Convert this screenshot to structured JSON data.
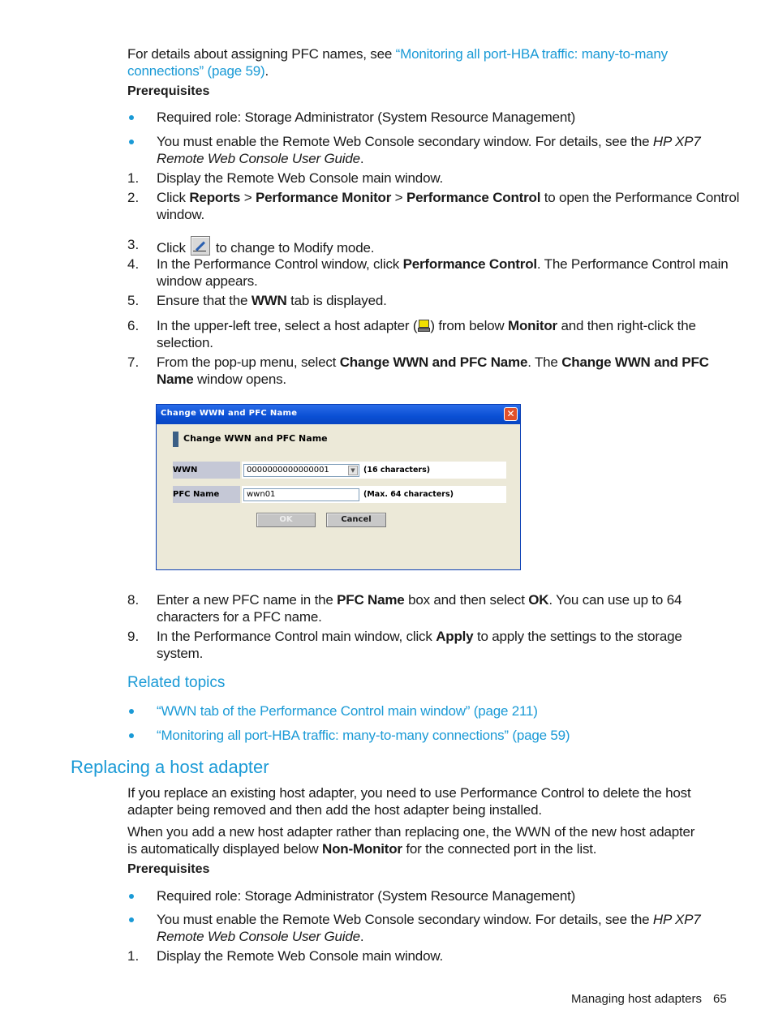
{
  "intro": {
    "text_before": "For details about assigning PFC names, see ",
    "link_line1": "“Monitoring all port-HBA traffic: many-to-many",
    "link_line2": "connections” (page 59)",
    "text_after": "."
  },
  "prereq1": {
    "heading": "Prerequisites",
    "bullets": [
      {
        "text": "Required role: Storage Administrator (System Resource Management)"
      },
      {
        "text": "You must enable the Remote Web Console secondary window. For details, see the ",
        "italic1": "HP XP7",
        "italic2": "Remote Web Console User Guide",
        "end": "."
      }
    ]
  },
  "steps": {
    "s1": {
      "num": "1.",
      "text": "Display the Remote Web Console main window."
    },
    "s2": {
      "num": "2.",
      "t1": "Click ",
      "b1": "Reports",
      "sep1": " > ",
      "b2": "Performance Monitor",
      "sep2": " > ",
      "b3": "Performance Control",
      "t2": " to open the Performance Control",
      "t3": "window."
    },
    "s3": {
      "num": "3.",
      "t1": "Click ",
      "icon": "modify-mode-icon",
      "t2": " to change to Modify mode."
    },
    "s4": {
      "num": "4.",
      "t1": "In the Performance Control window, click ",
      "b1": "Performance Control",
      "t2": ". The Performance Control main",
      "t3": "window appears."
    },
    "s5": {
      "num": "5.",
      "t1": "Ensure that the ",
      "b1": "WWN",
      "t2": " tab is displayed."
    },
    "s6": {
      "num": "6.",
      "t1": "In the upper-left tree, select a host adapter (",
      "icon": "host-adapter-icon",
      "t2": ") from below ",
      "b1": "Monitor",
      "t3": " and then right-click the",
      "t4": "selection."
    },
    "s7": {
      "num": "7.",
      "t1": "From the pop-up menu, select ",
      "b1": "Change WWN and PFC Name",
      "t2": ". The ",
      "b2": "Change WWN and PFC",
      "b3": "Name",
      "t3": " window opens."
    },
    "s8": {
      "num": "8.",
      "t1": "Enter a new PFC name in the ",
      "b1": "PFC Name",
      "t2": " box and then select ",
      "b2": "OK",
      "t3": ". You can use up to 64",
      "t4": "characters for a PFC name."
    },
    "s9": {
      "num": "9.",
      "t1": "In the Performance Control main window, click ",
      "b1": "Apply",
      "t2": " to apply the settings to the storage",
      "t3": "system."
    }
  },
  "dialog": {
    "title": "Change WWN and PFC Name",
    "heading": "Change WWN and PFC Name",
    "wwn_label": "WWN",
    "wwn_value": "0000000000000001",
    "wwn_hint": "(16 characters)",
    "pfc_label": "PFC Name",
    "pfc_value": "wwn01",
    "pfc_hint": "(Max. 64 characters)",
    "ok_label": "OK",
    "cancel_label": "Cancel",
    "close_glyph": "✕",
    "combo_glyph": "▼"
  },
  "related": {
    "heading": "Related topics",
    "links": [
      "“WWN tab of the Performance Control main window” (page 211)",
      "“Monitoring all port-HBA traffic: many-to-many connections” (page 59)"
    ]
  },
  "section2": {
    "heading": "Replacing a host adapter",
    "p1_l1": "If you replace an existing host adapter, you need to use Performance Control to delete the host",
    "p1_l2": "adapter being removed and then add the host adapter being installed.",
    "p2_l1": "When you add a new host adapter rather than replacing one, the WWN of the new host adapter",
    "p2_l2_a": "is automatically displayed below ",
    "p2_l2_b": "Non-Monitor",
    "p2_l2_c": " for the connected port in the list.",
    "prereq_heading": "Prerequisites",
    "bullet1": "Required role: Storage Administrator (System Resource Management)",
    "bullet2_a": "You must enable the Remote Web Console secondary window. For details, see the ",
    "bullet2_i1": "HP XP7",
    "bullet2_i2": "Remote Web Console User Guide",
    "bullet2_end": ".",
    "step1_num": "1.",
    "step1": "Display the Remote Web Console main window."
  },
  "footer": {
    "section": "Managing host adapters",
    "page": "65"
  },
  "colors": {
    "link": "#1a9ad6",
    "titlebar": "#0a4fd4",
    "dialog_bg": "#ece9d8"
  }
}
